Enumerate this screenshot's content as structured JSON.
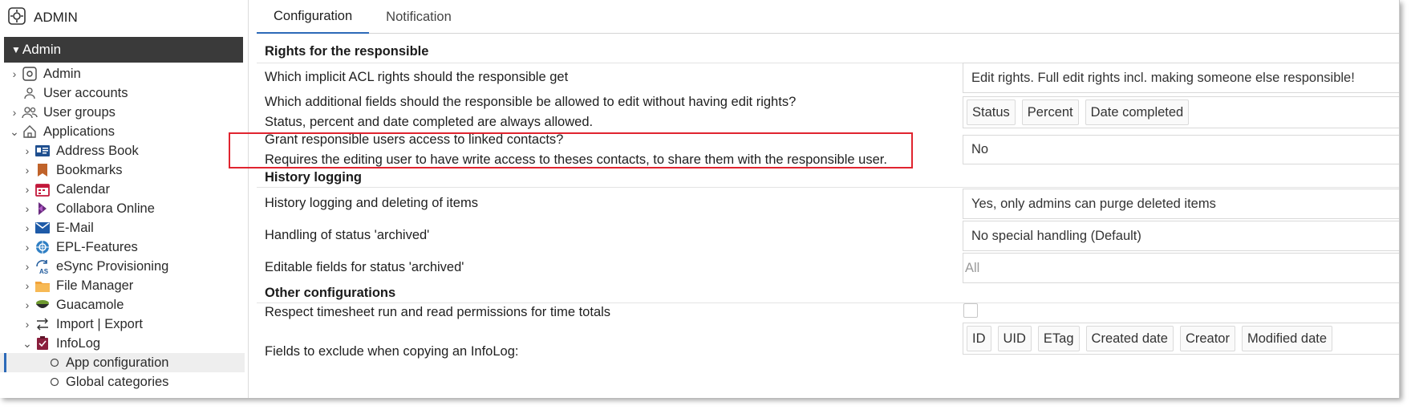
{
  "app": {
    "title": "ADMIN"
  },
  "sidebar": {
    "section_label": "Admin",
    "items": [
      {
        "label": "Admin",
        "icon": "admin-icon"
      },
      {
        "label": "User accounts",
        "icon": "user-icon"
      },
      {
        "label": "User groups",
        "icon": "users-icon"
      },
      {
        "label": "Applications",
        "icon": "home-icon"
      },
      {
        "label": "Address Book",
        "icon": "addressbook-icon"
      },
      {
        "label": "Bookmarks",
        "icon": "bookmark-icon"
      },
      {
        "label": "Calendar",
        "icon": "calendar-icon"
      },
      {
        "label": "Collabora Online",
        "icon": "collabora-icon"
      },
      {
        "label": "E-Mail",
        "icon": "mail-icon"
      },
      {
        "label": "EPL-Features",
        "icon": "epl-icon"
      },
      {
        "label": "eSync Provisioning",
        "icon": "esync-icon"
      },
      {
        "label": "File Manager",
        "icon": "folder-icon"
      },
      {
        "label": "Guacamole",
        "icon": "guacamole-icon"
      },
      {
        "label": "Import | Export",
        "icon": "import-export-icon"
      },
      {
        "label": "InfoLog",
        "icon": "infolog-icon"
      },
      {
        "label": "App configuration",
        "icon": "circle-icon"
      },
      {
        "label": "Global categories",
        "icon": "circle-icon"
      }
    ]
  },
  "tabs": [
    {
      "label": "Configuration"
    },
    {
      "label": "Notification"
    }
  ],
  "sections": {
    "rights": "Rights for the responsible",
    "history": "History logging",
    "other": "Other configurations"
  },
  "rows": {
    "implicit_acl": {
      "label": "Which implicit ACL rights should the responsible get",
      "value": "Edit rights. Full edit rights incl. making someone else responsible!"
    },
    "additional_fields": {
      "label": "Which additional fields should the responsible be allowed to edit without having edit rights?",
      "note": "Status, percent and date completed are always allowed.",
      "chips": [
        "Status",
        "Percent",
        "Date completed"
      ]
    },
    "grant_contacts": {
      "label": "Grant responsible users access to linked contacts?",
      "note": "Requires the editing user to have write access to theses contacts, to share them with the responsible user.",
      "value": "No"
    },
    "history_logging": {
      "label": "History logging and deleting of items",
      "value": "Yes, only admins can purge deleted items"
    },
    "archived_handling": {
      "label": "Handling of status 'archived'",
      "value": "No special handling (Default)"
    },
    "archived_fields": {
      "label": "Editable fields for status 'archived'",
      "placeholder": "All"
    },
    "timesheet": {
      "label": "Respect timesheet run and read permissions for time totals"
    },
    "exclude_fields": {
      "label": "Fields to exclude when copying an InfoLog:",
      "chips": [
        "ID",
        "UID",
        "ETag",
        "Created date",
        "Creator",
        "Modified date"
      ]
    }
  },
  "colors": {
    "accent": "#2d6ab8",
    "highlight": "#e0242f",
    "admin_bar": "#3a3a3a"
  }
}
